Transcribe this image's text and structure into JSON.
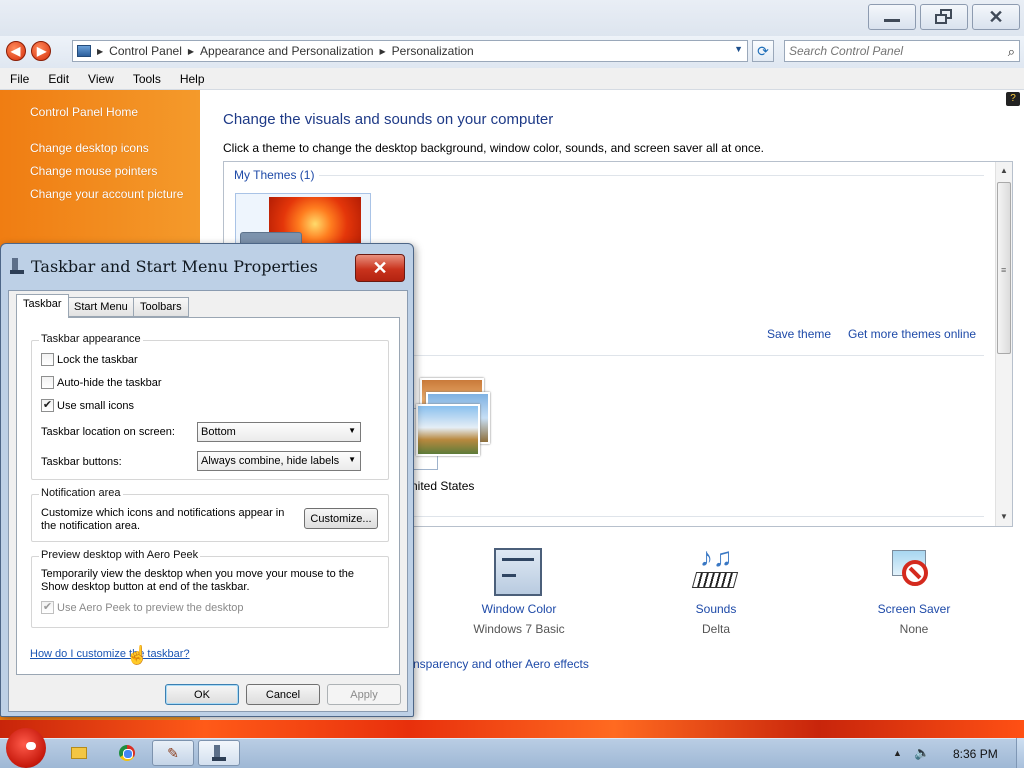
{
  "control_panel": {
    "address_segments": [
      "Control Panel",
      "Appearance and Personalization",
      "Personalization"
    ],
    "search_placeholder": "Search Control Panel",
    "menu": [
      "File",
      "Edit",
      "View",
      "Tools",
      "Help"
    ],
    "sidebar": {
      "home": "Control Panel Home",
      "links": [
        "Change desktop icons",
        "Change mouse pointers",
        "Change your account picture"
      ]
    },
    "heading": "Change the visuals and sounds on your computer",
    "subheading": "Click a theme to change the desktop background, window color, sounds, and screen saver all at once.",
    "my_themes_label": "My Themes (1)",
    "save_theme": "Save theme",
    "more_themes": "Get more themes online",
    "partial_theme_label": "nited States",
    "bottom_items": [
      {
        "label": "Window Color",
        "value": "Windows 7 Basic"
      },
      {
        "label": "Sounds",
        "value": "Delta"
      },
      {
        "label": "Screen Saver",
        "value": "None"
      }
    ],
    "aero_link": "nsparency and other Aero effects"
  },
  "dialog": {
    "title": "Taskbar and Start Menu Properties",
    "tabs": [
      "Taskbar",
      "Start Menu",
      "Toolbars"
    ],
    "appearance": {
      "title": "Taskbar appearance",
      "lock": "Lock the taskbar",
      "autohide": "Auto-hide the taskbar",
      "small_icons": "Use small icons",
      "lock_checked": false,
      "autohide_checked": false,
      "small_icons_checked": true,
      "location_label": "Taskbar location on screen:",
      "location_value": "Bottom",
      "buttons_label": "Taskbar buttons:",
      "buttons_value": "Always combine, hide labels"
    },
    "notification": {
      "title": "Notification area",
      "text": "Customize which icons and notifications appear in the notification area.",
      "button": "Customize..."
    },
    "aero": {
      "title": "Preview desktop with Aero Peek",
      "text": "Temporarily view the desktop when you move your mouse to the Show desktop button at end of the taskbar.",
      "checkbox": "Use Aero Peek to preview the desktop",
      "checked": true,
      "disabled": true
    },
    "help_link": "How do I customize the taskbar?",
    "buttons": {
      "ok": "OK",
      "cancel": "Cancel",
      "apply": "Apply"
    }
  },
  "taskbar": {
    "time": "8:36 PM"
  },
  "colors": {
    "sidebar_orange": "#f07d12",
    "link_blue": "#1e4aa8",
    "dialog_close_red": "#c9331d"
  }
}
